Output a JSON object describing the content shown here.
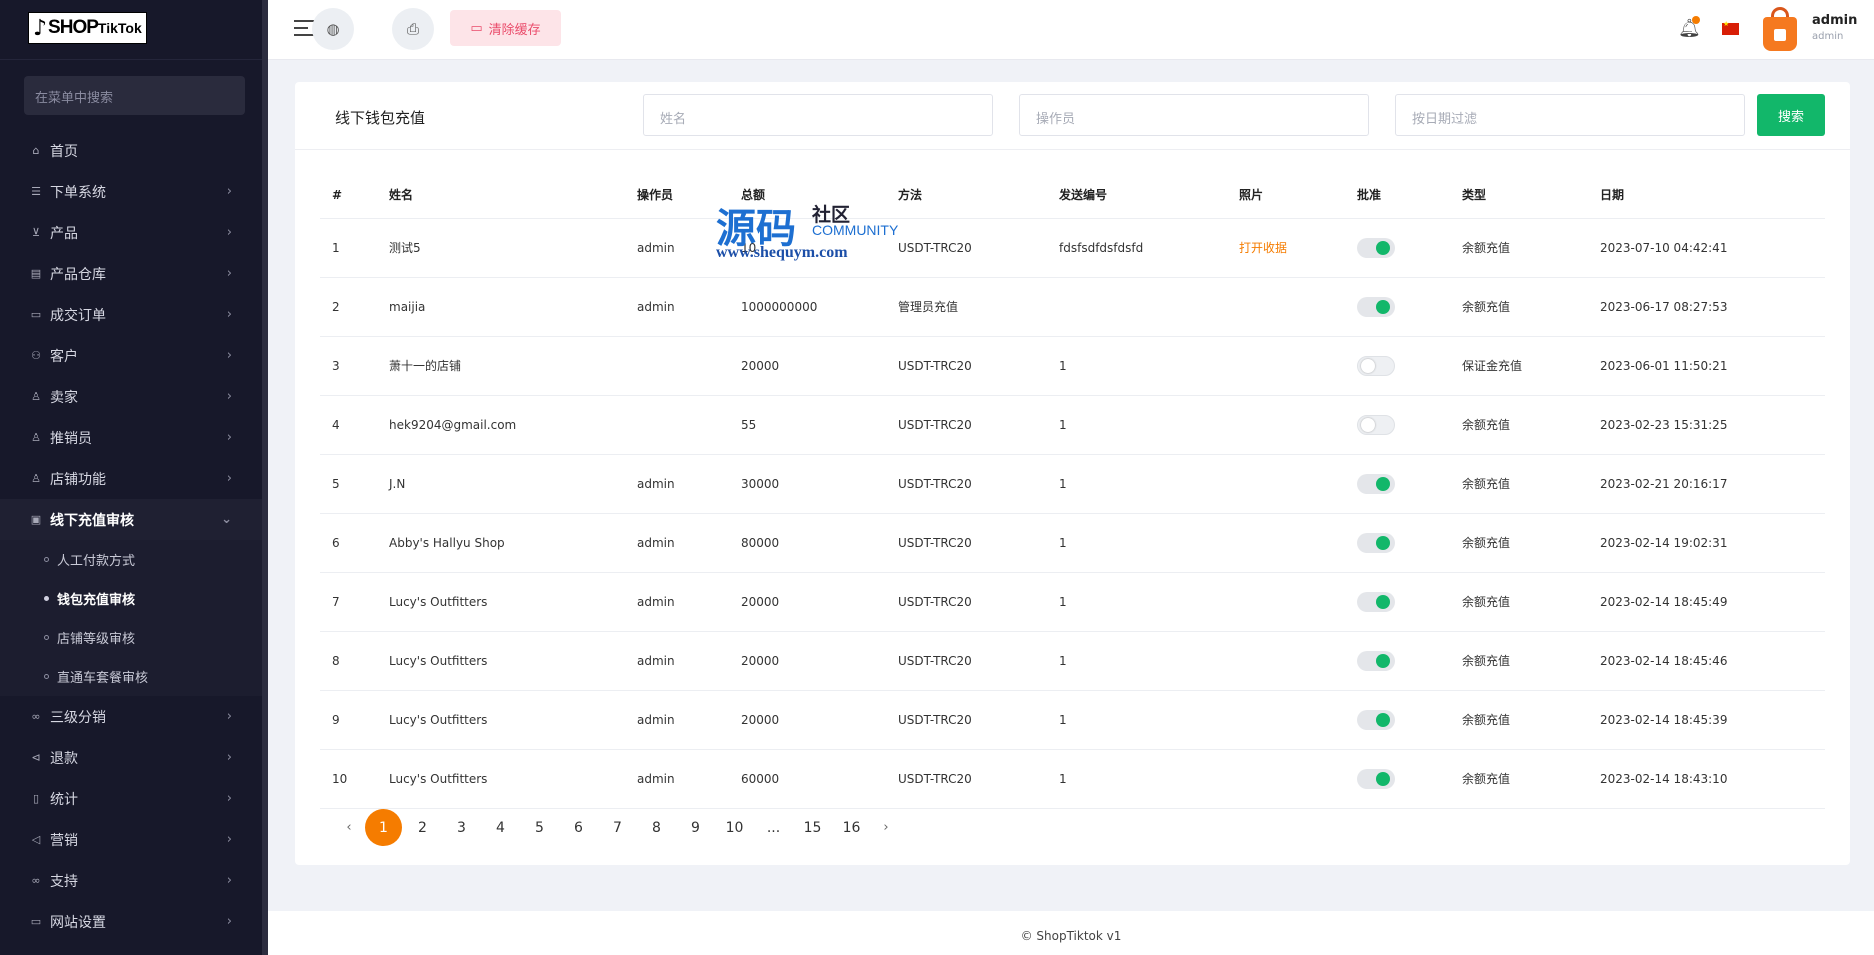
{
  "logo": {
    "brand": "SHOP",
    "brand_suffix": "TikTok"
  },
  "sidebar": {
    "search_placeholder": "在菜单中搜索",
    "items": [
      {
        "label": "首页",
        "icon": "home-icon"
      },
      {
        "label": "下单系统",
        "icon": "list-icon"
      },
      {
        "label": "产品",
        "icon": "cart-icon"
      },
      {
        "label": "产品仓库",
        "icon": "warehouse-icon"
      },
      {
        "label": "成交订单",
        "icon": "orders-icon"
      },
      {
        "label": "客户",
        "icon": "users-icon"
      },
      {
        "label": "卖家",
        "icon": "user-icon"
      },
      {
        "label": "推销员",
        "icon": "user-icon"
      },
      {
        "label": "店铺功能",
        "icon": "user-icon"
      },
      {
        "label": "线下充值审核",
        "icon": "card-icon"
      },
      {
        "label": "三级分销",
        "icon": "link-icon"
      },
      {
        "label": "退款",
        "icon": "refund-icon"
      },
      {
        "label": "统计",
        "icon": "document-icon"
      },
      {
        "label": "营销",
        "icon": "megaphone-icon"
      },
      {
        "label": "支持",
        "icon": "link-icon"
      },
      {
        "label": "网站设置",
        "icon": "monitor-icon"
      }
    ],
    "submenu": [
      {
        "label": "人工付款方式"
      },
      {
        "label": "钱包充值审核"
      },
      {
        "label": "店铺等级审核"
      },
      {
        "label": "直通车套餐审核"
      }
    ]
  },
  "header": {
    "clear_cache": "清除缓存",
    "user_name": "admin",
    "user_role": "admin"
  },
  "card": {
    "title": "线下钱包充值",
    "filters": {
      "name": "姓名",
      "operator": "操作员",
      "date": "按日期过滤"
    },
    "search_button": "搜索"
  },
  "table": {
    "headers": [
      "#",
      "姓名",
      "操作员",
      "总额",
      "方法",
      "发送编号",
      "照片",
      "批准",
      "类型",
      "日期"
    ],
    "rows": [
      {
        "no": "1",
        "name": "测试5",
        "operator": "admin",
        "amount": "10",
        "method": "USDT-TRC20",
        "send_no": "fdsfsdfdsfdsfd",
        "photo": "打开收据",
        "approved": true,
        "type": "余额充值",
        "date": "2023-07-10 04:42:41"
      },
      {
        "no": "2",
        "name": "maijia",
        "operator": "admin",
        "amount": "1000000000",
        "method": "管理员充值",
        "send_no": "",
        "photo": "",
        "approved": true,
        "type": "余额充值",
        "date": "2023-06-17 08:27:53"
      },
      {
        "no": "3",
        "name": "萧十一的店铺",
        "operator": "",
        "amount": "20000",
        "method": "USDT-TRC20",
        "send_no": "1",
        "photo": "",
        "approved": false,
        "type": "保证金充值",
        "date": "2023-06-01 11:50:21"
      },
      {
        "no": "4",
        "name": "hek9204@gmail.com",
        "operator": "",
        "amount": "55",
        "method": "USDT-TRC20",
        "send_no": "1",
        "photo": "",
        "approved": false,
        "type": "余额充值",
        "date": "2023-02-23 15:31:25"
      },
      {
        "no": "5",
        "name": "J.N",
        "operator": "admin",
        "amount": "30000",
        "method": "USDT-TRC20",
        "send_no": "1",
        "photo": "",
        "approved": true,
        "type": "余额充值",
        "date": "2023-02-21 20:16:17"
      },
      {
        "no": "6",
        "name": "Abby's Hallyu Shop",
        "operator": "admin",
        "amount": "80000",
        "method": "USDT-TRC20",
        "send_no": "1",
        "photo": "",
        "approved": true,
        "type": "余额充值",
        "date": "2023-02-14 19:02:31"
      },
      {
        "no": "7",
        "name": "Lucy's Outfitters",
        "operator": "admin",
        "amount": "20000",
        "method": "USDT-TRC20",
        "send_no": "1",
        "photo": "",
        "approved": true,
        "type": "余额充值",
        "date": "2023-02-14 18:45:49"
      },
      {
        "no": "8",
        "name": "Lucy's Outfitters",
        "operator": "admin",
        "amount": "20000",
        "method": "USDT-TRC20",
        "send_no": "1",
        "photo": "",
        "approved": true,
        "type": "余额充值",
        "date": "2023-02-14 18:45:46"
      },
      {
        "no": "9",
        "name": "Lucy's Outfitters",
        "operator": "admin",
        "amount": "20000",
        "method": "USDT-TRC20",
        "send_no": "1",
        "photo": "",
        "approved": true,
        "type": "余额充值",
        "date": "2023-02-14 18:45:39"
      },
      {
        "no": "10",
        "name": "Lucy's Outfitters",
        "operator": "admin",
        "amount": "60000",
        "method": "USDT-TRC20",
        "send_no": "1",
        "photo": "",
        "approved": true,
        "type": "余额充值",
        "date": "2023-02-14 18:43:10"
      }
    ]
  },
  "pagination": {
    "prev": "‹",
    "next": "›",
    "pages": [
      "1",
      "2",
      "3",
      "4",
      "5",
      "6",
      "7",
      "8",
      "9",
      "10",
      "...",
      "15",
      "16"
    ],
    "current": "1"
  },
  "footer": {
    "text": "© ShopTiktok v1"
  },
  "watermark": {
    "big": "源码",
    "zh": "社区",
    "en": "COMMUNITY",
    "url": "www.shequym.com"
  },
  "colors": {
    "accent": "#f57c00",
    "success": "#12b76a",
    "sidebar_bg": "#17182a",
    "danger_soft": "#fde4e8"
  }
}
